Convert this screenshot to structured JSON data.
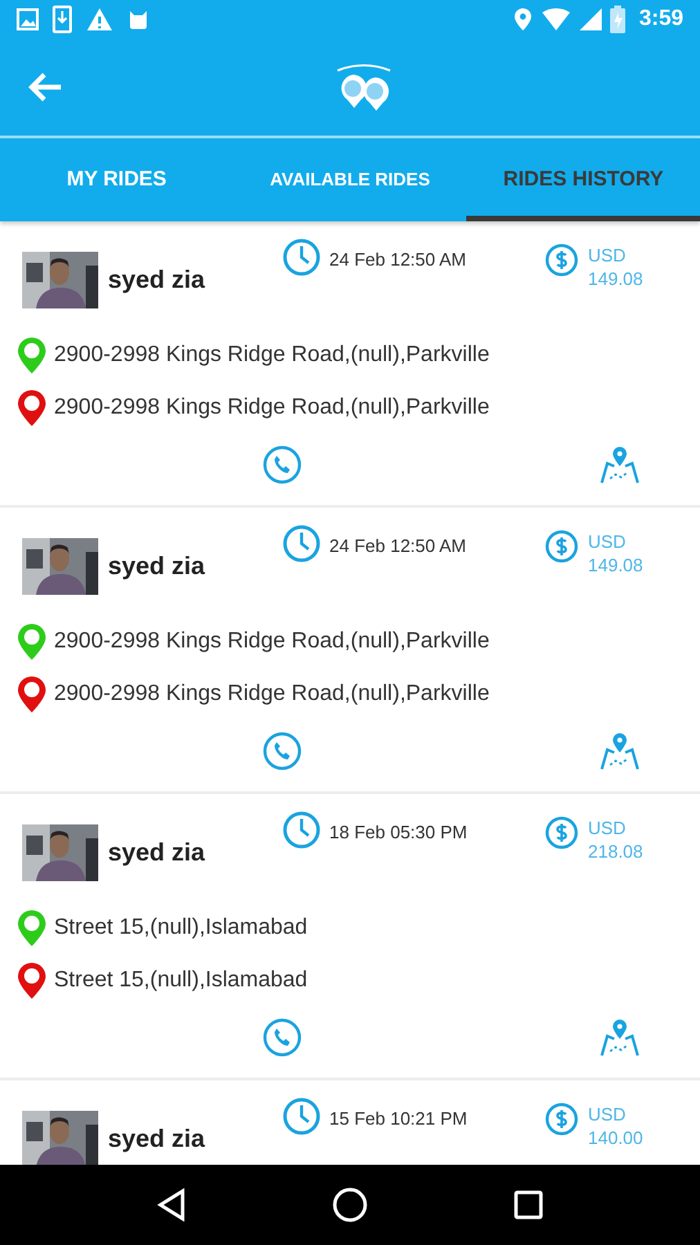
{
  "status_bar": {
    "time": "3:59"
  },
  "tabs": [
    {
      "label": "MY RIDES",
      "selected": false
    },
    {
      "label": "AVAILABLE RIDES",
      "selected": false
    },
    {
      "label": "RIDES HISTORY",
      "selected": true
    }
  ],
  "rides": [
    {
      "name": "syed zia",
      "datetime": "24 Feb 12:50 AM",
      "currency": "USD",
      "amount": "149.08",
      "pickup": "2900-2998 Kings Ridge Road,(null),Parkville",
      "dropoff": "2900-2998 Kings Ridge Road,(null),Parkville"
    },
    {
      "name": "syed zia",
      "datetime": "24 Feb 12:50 AM",
      "currency": "USD",
      "amount": "149.08",
      "pickup": "2900-2998 Kings Ridge Road,(null),Parkville",
      "dropoff": "2900-2998 Kings Ridge Road,(null),Parkville"
    },
    {
      "name": "syed zia",
      "datetime": "18 Feb 05:30 PM",
      "currency": "USD",
      "amount": "218.08",
      "pickup": "Street 15,(null),Islamabad",
      "dropoff": "Street 15,(null),Islamabad"
    },
    {
      "name": "syed zia",
      "datetime": "15 Feb 10:21 PM",
      "currency": "USD",
      "amount": "140.00"
    }
  ]
}
